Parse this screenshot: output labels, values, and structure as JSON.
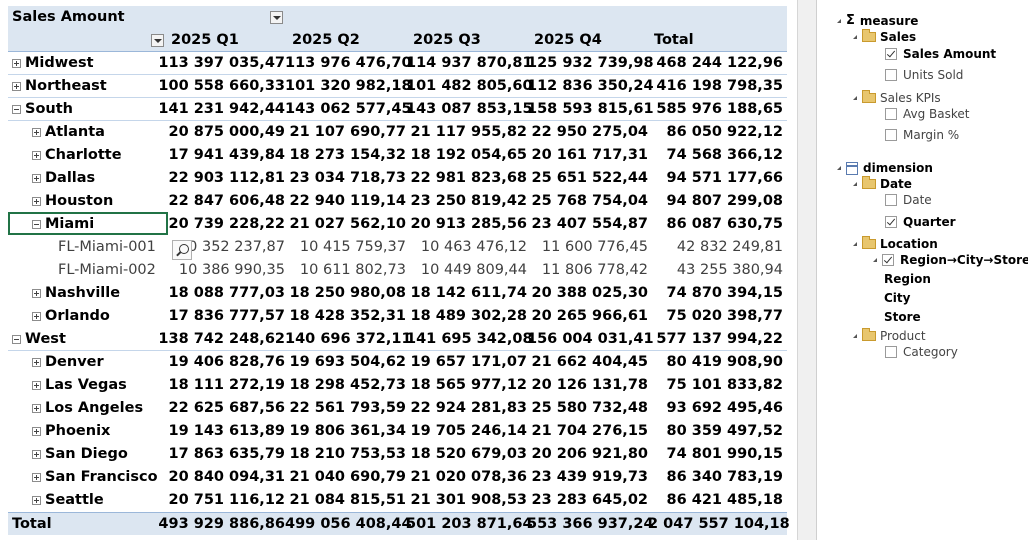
{
  "pivot": {
    "row_header": "Sales Amount",
    "columns": [
      "2025 Q1",
      "2025 Q2",
      "2025 Q3",
      "2025 Q4",
      "Total"
    ],
    "rows": [
      {
        "label": "Midwest",
        "level": 0,
        "expander": "plus",
        "values": [
          "113 397 035,47",
          "113 976 476,70",
          "114 937 870,81",
          "125 932 739,98",
          "468 244 122,96"
        ]
      },
      {
        "label": "Northeast",
        "level": 0,
        "expander": "plus",
        "values": [
          "100 558 660,33",
          "101 320 982,18",
          "101 482 805,60",
          "112 836 350,24",
          "416 198 798,35"
        ]
      },
      {
        "label": "South",
        "level": 0,
        "expander": "minus",
        "values": [
          "141 231 942,44",
          "143 062 577,45",
          "143 087 853,15",
          "158 593 815,61",
          "585 976 188,65"
        ]
      },
      {
        "label": "Atlanta",
        "level": 1,
        "expander": "plus",
        "values": [
          "20 875 000,49",
          "21 107 690,77",
          "21 117 955,82",
          "22 950 275,04",
          "86 050 922,12"
        ]
      },
      {
        "label": "Charlotte",
        "level": 1,
        "expander": "plus",
        "values": [
          "17 941 439,84",
          "18 273 154,32",
          "18 192 054,65",
          "20 161 717,31",
          "74 568 366,12"
        ]
      },
      {
        "label": "Dallas",
        "level": 1,
        "expander": "plus",
        "values": [
          "22 903 112,81",
          "23 034 718,73",
          "22 981 823,68",
          "25 651 522,44",
          "94 571 177,66"
        ]
      },
      {
        "label": "Houston",
        "level": 1,
        "expander": "plus",
        "values": [
          "22 847 606,48",
          "22 940 119,14",
          "23 250 819,42",
          "25 768 754,04",
          "94 807 299,08"
        ]
      },
      {
        "label": "Miami",
        "level": 1,
        "expander": "minus",
        "values": [
          "20 739 228,22",
          "21 027 562,10",
          "20 913 285,56",
          "23 407 554,87",
          "86 087 630,75"
        ]
      },
      {
        "label": "FL-Miami-001",
        "level": 2,
        "expander": "none",
        "values": [
          "0 352 237,87",
          "10 415 759,37",
          "10 463 476,12",
          "11 600 776,45",
          "42 832 249,81"
        ]
      },
      {
        "label": "FL-Miami-002",
        "level": 2,
        "expander": "none",
        "values": [
          "10 386 990,35",
          "10 611 802,73",
          "10 449 809,44",
          "11 806 778,42",
          "43 255 380,94"
        ]
      },
      {
        "label": "Nashville",
        "level": 1,
        "expander": "plus",
        "values": [
          "18 088 777,03",
          "18 250 980,08",
          "18 142 611,74",
          "20 388 025,30",
          "74 870 394,15"
        ]
      },
      {
        "label": "Orlando",
        "level": 1,
        "expander": "plus",
        "values": [
          "17 836 777,57",
          "18 428 352,31",
          "18 489 302,28",
          "20 265 966,61",
          "75 020 398,77"
        ]
      },
      {
        "label": "West",
        "level": 0,
        "expander": "minus",
        "values": [
          "138 742 248,62",
          "140 696 372,11",
          "141 695 342,08",
          "156 004 031,41",
          "577 137 994,22"
        ]
      },
      {
        "label": "Denver",
        "level": 1,
        "expander": "plus",
        "values": [
          "19 406 828,76",
          "19 693 504,62",
          "19 657 171,07",
          "21 662 404,45",
          "80 419 908,90"
        ]
      },
      {
        "label": "Las Vegas",
        "level": 1,
        "expander": "plus",
        "values": [
          "18 111 272,19",
          "18 298 452,73",
          "18 565 977,12",
          "20 126 131,78",
          "75 101 833,82"
        ]
      },
      {
        "label": "Los Angeles",
        "level": 1,
        "expander": "plus",
        "values": [
          "22 625 687,56",
          "22 561 793,59",
          "22 924 281,83",
          "25 580 732,48",
          "93 692 495,46"
        ]
      },
      {
        "label": "Phoenix",
        "level": 1,
        "expander": "plus",
        "values": [
          "19 143 613,89",
          "19 806 361,34",
          "19 705 246,14",
          "21 704 276,15",
          "80 359 497,52"
        ]
      },
      {
        "label": "San Diego",
        "level": 1,
        "expander": "plus",
        "values": [
          "17 863 635,79",
          "18 210 753,53",
          "18 520 679,03",
          "20 206 921,80",
          "74 801 990,15"
        ]
      },
      {
        "label": "San Francisco",
        "level": 1,
        "expander": "plus",
        "values": [
          "20 840 094,31",
          "21 040 690,79",
          "21 020 078,36",
          "23 439 919,73",
          "86 340 783,19"
        ]
      },
      {
        "label": "Seattle",
        "level": 1,
        "expander": "plus",
        "values": [
          "20 751 116,12",
          "21 084 815,51",
          "21 301 908,53",
          "23 283 645,02",
          "86 421 485,18"
        ]
      }
    ],
    "total": {
      "label": "Total",
      "values": [
        "493 929 886,86",
        "499 056 408,44",
        "501 203 871,64",
        "553 366 937,24",
        "2 047 557 104,18"
      ]
    },
    "selected_row": "Miami"
  },
  "fields": {
    "measure_label": "measure",
    "sales_folder": "Sales",
    "sales_amount": "Sales Amount",
    "units_sold": "Units Sold",
    "kpi_folder": "Sales KPIs",
    "avg_basket": "Avg Basket",
    "margin": "Margin %",
    "dimension_label": "dimension",
    "date_folder": "Date",
    "date_item": "Date",
    "quarter_item": "Quarter",
    "location_folder": "Location",
    "hierarchy_item": "Region→City→Store",
    "region_level": "Region",
    "city_level": "City",
    "store_level": "Store",
    "product_folder": "Product",
    "category_item": "Category"
  },
  "icons": {
    "expand": "plus-box-icon",
    "collapse": "minus-box-icon",
    "filter": "dropdown-icon",
    "zoom": "magnifier-icon",
    "folder": "folder-icon",
    "table": "table-icon",
    "sigma": "sigma-icon"
  }
}
